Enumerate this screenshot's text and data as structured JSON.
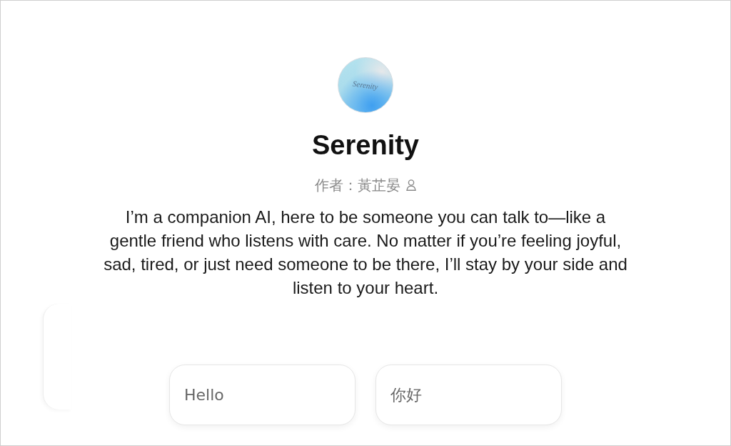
{
  "agent": {
    "avatar_text": "Serenity",
    "name": "Serenity",
    "author": "作者：黃芷晏",
    "description": "I’m a companion AI, here to be someone you can talk to—like a gentle friend who listens with care. No matter if you’re feeling joyful, sad, tired, or just need someone to be there, I’ll stay by your side and listen to your heart."
  },
  "suggestions": [
    {
      "label": "Hello"
    },
    {
      "label": "你好"
    }
  ]
}
